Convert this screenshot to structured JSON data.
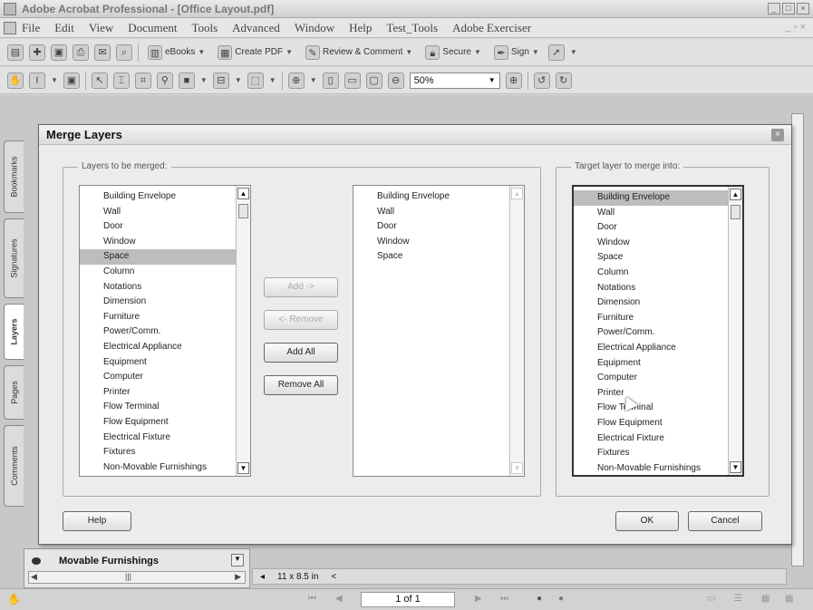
{
  "app": {
    "title": "Adobe Acrobat Professional - [Office Layout.pdf]"
  },
  "menu": [
    "File",
    "Edit",
    "View",
    "Document",
    "Tools",
    "Advanced",
    "Window",
    "Help",
    "Test_Tools",
    "Adobe Exerciser"
  ],
  "toolbar1": {
    "ebooks": "eBooks",
    "create_pdf": "Create PDF",
    "review": "Review & Comment",
    "secure": "Secure",
    "sign": "Sign"
  },
  "toolbar2": {
    "zoom": "50%"
  },
  "side_tabs": [
    "Bookmarks",
    "Signatures",
    "Layers",
    "Pages",
    "Comments"
  ],
  "layers_panel": {
    "bottom_layer": "Movable Furnishings",
    "page_size": "11 x 8.5 in"
  },
  "dialog": {
    "title": "Merge Layers",
    "group_left_label": "Layers to be merged:",
    "group_right_label": "Target layer to merge into:",
    "source_list": [
      "Building Envelope",
      "Wall",
      "Door",
      "Window",
      "Space",
      "Column",
      "Notations",
      "Dimension",
      "Furniture",
      "Power/Comm.",
      "Electrical Appliance",
      "Equipment",
      "Computer",
      "Printer",
      "Flow Terminal",
      "Flow Equipment",
      "Electrical Fixture",
      "Fixtures",
      "Non-Movable Furnishings"
    ],
    "source_selected": "Space",
    "merge_list": [
      "Building Envelope",
      "Wall",
      "Door",
      "Window",
      "Space"
    ],
    "target_list": [
      "Building Envelope",
      "Wall",
      "Door",
      "Window",
      "Space",
      "Column",
      "Notations",
      "Dimension",
      "Furniture",
      "Power/Comm.",
      "Electrical Appliance",
      "Equipment",
      "Computer",
      "Printer",
      "Flow Terminal",
      "Flow Equipment",
      "Electrical Fixture",
      "Fixtures",
      "Non-Movable Furnishings"
    ],
    "target_selected": "Building Envelope",
    "buttons": {
      "add": "Add ->",
      "remove": "<- Remove",
      "add_all": "Add All",
      "remove_all": "Remove All",
      "help": "Help",
      "ok": "OK",
      "cancel": "Cancel"
    }
  },
  "status": {
    "page": "1 of 1"
  }
}
